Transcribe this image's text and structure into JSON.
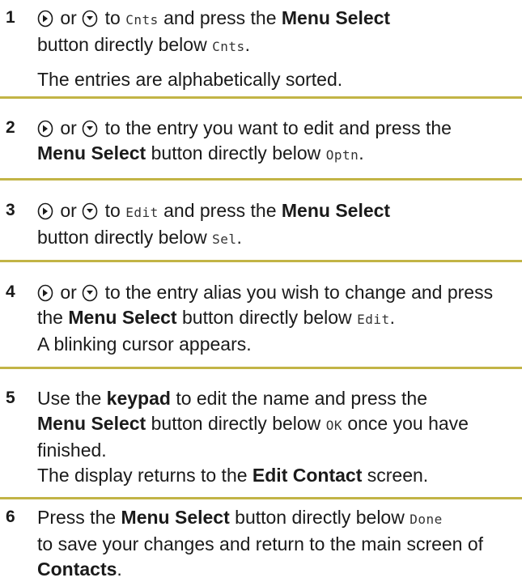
{
  "accent_color": "#c2b446",
  "icons": {
    "up": "nav-up-icon",
    "down": "nav-down-icon"
  },
  "steps": [
    {
      "number": "1",
      "or": "or",
      "t1": "to",
      "m1": "Cnts",
      "t2": "and press the",
      "b1": "Menu Select",
      "t3": "button directly below",
      "m2": "Cnts",
      "t4": ".",
      "note": "The entries are alphabetically sorted."
    },
    {
      "number": "2",
      "or": "or",
      "t1": "to the entry you want to edit and press the",
      "b1": "Menu Select",
      "t2": "button directly below",
      "m1": "Optn",
      "t3": "."
    },
    {
      "number": "3",
      "or": "or",
      "t1": "to",
      "m1": "Edit",
      "t2": "and press the",
      "b1": "Menu Select",
      "t3": "button directly below",
      "m2": "Sel",
      "t4": "."
    },
    {
      "number": "4",
      "or": "or",
      "t1": "to the entry alias you wish to change and press the",
      "b1": "Menu Select",
      "t2": "button directly below",
      "m1": "Edit",
      "t3": ".",
      "t4": "A blinking cursor appears."
    },
    {
      "number": "5",
      "t1": "Use the",
      "b1": "keypad",
      "t2": "to edit the name and press the",
      "b2": "Menu Select",
      "t3": "button directly below",
      "m1": "OK",
      "t4": "once you have finished.",
      "t5": "The display returns to the",
      "b3": "Edit Contact",
      "t6": "screen."
    },
    {
      "number": "6",
      "t1": "Press the",
      "b1": "Menu Select",
      "t2": "button directly below",
      "m1": "Done",
      "t3": "to save your changes and return to the main screen of",
      "b2": "Contacts",
      "t4": "."
    }
  ]
}
